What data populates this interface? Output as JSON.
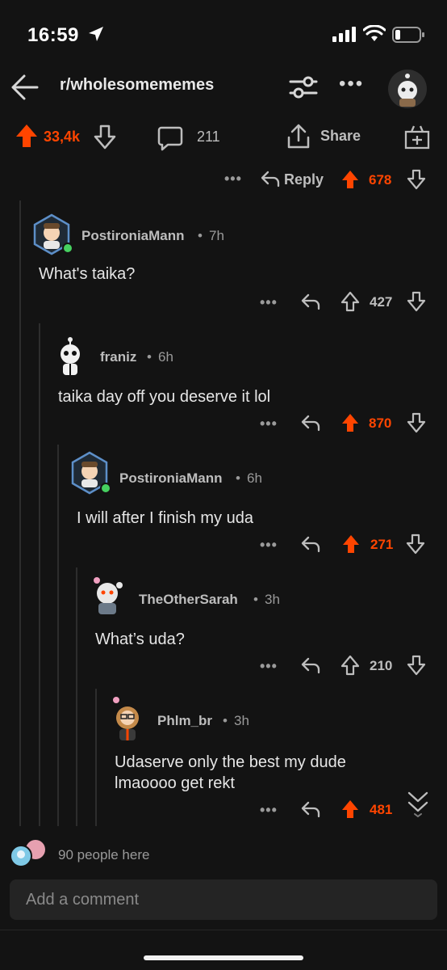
{
  "status": {
    "time": "16:59"
  },
  "nav": {
    "subreddit": "r/wholesomememes",
    "more": "•••"
  },
  "post": {
    "upvotes": "33,4k",
    "comments": "211",
    "share_label": "Share"
  },
  "parent_actions": {
    "more": "•••",
    "reply_label": "Reply",
    "score": "678"
  },
  "comments": [
    {
      "username": "PostironiaMann",
      "sep": "•",
      "age": "7h",
      "text": "What's taika?",
      "more": "•••",
      "score": "427"
    },
    {
      "username": "franiz",
      "sep": "•",
      "age": "6h",
      "text": "taika day off you deserve it lol",
      "more": "•••",
      "score": "870"
    },
    {
      "username": "PostironiaMann",
      "sep": "•",
      "age": "6h",
      "text": "I will after I finish my uda",
      "more": "•••",
      "score": "271"
    },
    {
      "username": "TheOtherSarah",
      "sep": "•",
      "age": "3h",
      "text": "What’s uda?",
      "more": "•••",
      "score": "210"
    },
    {
      "username": "Phlm_br",
      "sep": "•",
      "age": "3h",
      "text_line1": "Udaserve only the best my dude",
      "text_line2": "lmaoooo get rekt",
      "more": "•••",
      "score": "481"
    }
  ],
  "footer": {
    "people_here": "90 people here",
    "comment_placeholder": "Add a comment"
  },
  "colors": {
    "accent": "#ff4500",
    "background": "#131313",
    "online": "#46d160"
  }
}
